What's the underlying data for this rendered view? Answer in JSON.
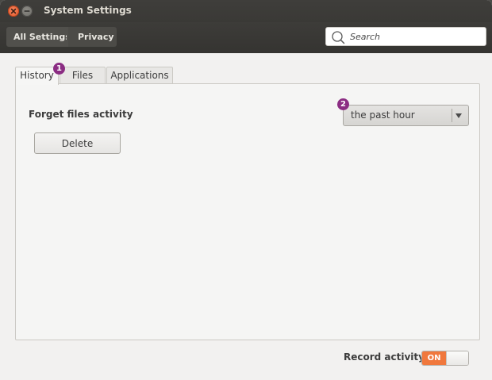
{
  "window": {
    "title": "System Settings"
  },
  "breadcrumb": {
    "home": "All Settings",
    "current": "Privacy"
  },
  "search": {
    "placeholder": "Search",
    "value": ""
  },
  "tabs": [
    {
      "label": "History",
      "active": true
    },
    {
      "label": "Files",
      "active": false
    },
    {
      "label": "Applications",
      "active": false
    }
  ],
  "annotations": {
    "badge_1": "1",
    "badge_2": "2",
    "badge_color": "#8b2d83"
  },
  "history": {
    "forget_label": "Forget files activity",
    "delete_label": "Delete",
    "period_selected": "the past hour"
  },
  "footer": {
    "record_label": "Record activity",
    "switch_label": "ON",
    "switch_state": true,
    "switch_color": "#f0783d"
  },
  "icons": {
    "close": "close-icon",
    "minimize": "minimize-icon",
    "search": "search-icon",
    "dropdown": "chevron-down-icon"
  }
}
